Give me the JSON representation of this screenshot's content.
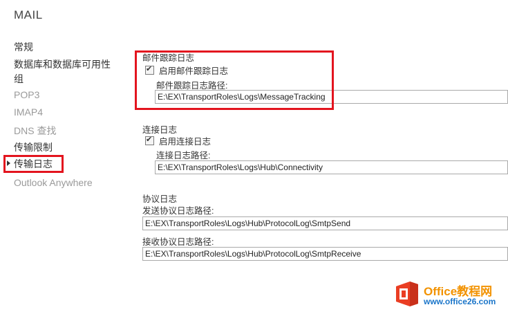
{
  "page": {
    "title": "MAIL"
  },
  "sidebar": {
    "items": [
      {
        "label": "常规",
        "disabled": false
      },
      {
        "label": "数据库和数据库可用性",
        "disabled": false
      },
      {
        "label": "组",
        "disabled": false
      },
      {
        "label": "POP3",
        "disabled": true
      },
      {
        "label": "IMAP4",
        "disabled": true
      },
      {
        "label": "DNS 查找",
        "disabled": false
      },
      {
        "label": "传输限制",
        "disabled": false
      },
      {
        "label": "传输日志",
        "disabled": false,
        "selected": true
      },
      {
        "label": "Outlook Anywhere",
        "disabled": true
      }
    ]
  },
  "message_tracking": {
    "section_label": "邮件跟踪日志",
    "enable_label": "启用邮件跟踪日志",
    "enabled": true,
    "path_label": "邮件跟踪日志路径:",
    "path_value": "E:\\EX\\TransportRoles\\Logs\\MessageTracking"
  },
  "connectivity": {
    "section_label": "连接日志",
    "enable_label": "启用连接日志",
    "enabled": true,
    "path_label": "连接日志路径:",
    "path_value": "E:\\EX\\TransportRoles\\Logs\\Hub\\Connectivity"
  },
  "protocol": {
    "section_label": "协议日志",
    "send_label": "发送协议日志路径:",
    "send_value": "E:\\EX\\TransportRoles\\Logs\\Hub\\ProtocolLog\\SmtpSend",
    "receive_label": "接收协议日志路径:",
    "receive_value": "E:\\EX\\TransportRoles\\Logs\\Hub\\ProtocolLog\\SmtpReceive"
  },
  "watermark": {
    "name": "Office教程网",
    "url": "www.office26.com"
  },
  "colors": {
    "highlight": "#e3141e",
    "watermark_orange": "#f29200",
    "watermark_blue": "#1a75c9"
  }
}
